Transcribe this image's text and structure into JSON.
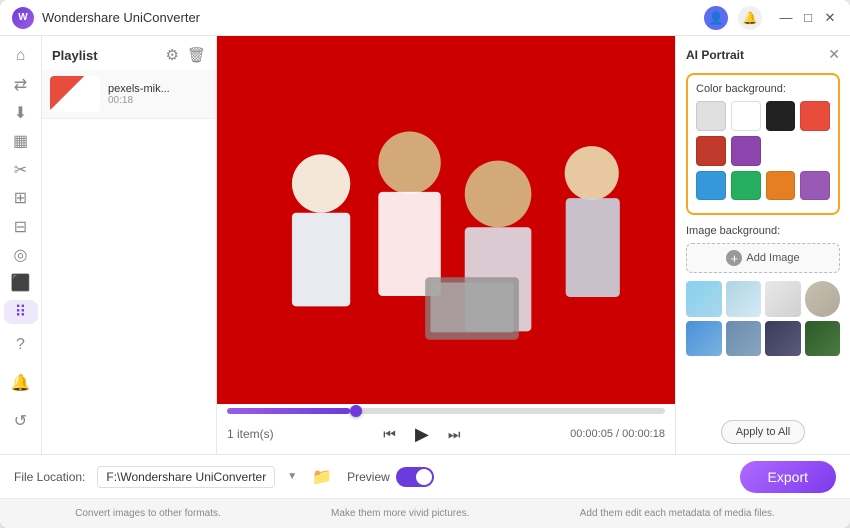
{
  "app": {
    "title": "Wondershare UniConverter",
    "logo_text": "W"
  },
  "titlebar": {
    "icons": [
      "user-icon",
      "bell-icon"
    ],
    "controls": [
      "minimize",
      "maximize",
      "close"
    ],
    "minimize_label": "—",
    "maximize_label": "□",
    "close_label": "✕"
  },
  "sidebar": {
    "items": [
      {
        "id": "home",
        "icon": "⌂",
        "label": "Home"
      },
      {
        "id": "convert",
        "icon": "↔",
        "label": "Convert"
      },
      {
        "id": "download",
        "icon": "↓",
        "label": "Download"
      },
      {
        "id": "screen",
        "icon": "▦",
        "label": "Screen"
      },
      {
        "id": "cut",
        "icon": "✂",
        "label": "Cut"
      },
      {
        "id": "merge",
        "icon": "⊞",
        "label": "Merge"
      },
      {
        "id": "watermark",
        "icon": "⊟",
        "label": "Watermark"
      },
      {
        "id": "effects",
        "icon": "◈",
        "label": "Effects"
      },
      {
        "id": "toolbox",
        "icon": "⊞",
        "label": "Toolbox"
      },
      {
        "id": "ai",
        "icon": "⠿",
        "label": "AI Tools",
        "active": true
      }
    ],
    "bottom": [
      {
        "id": "help",
        "icon": "?",
        "label": "Help"
      },
      {
        "id": "notifications",
        "icon": "🔔",
        "label": "Notifications"
      },
      {
        "id": "settings",
        "icon": "↺",
        "label": "Settings"
      }
    ]
  },
  "playlist": {
    "title": "Playlist",
    "count_label": "1 item(s)",
    "items": [
      {
        "name": "pexels-mik...",
        "duration": "00:18"
      }
    ]
  },
  "video": {
    "current_time": "00:00:05",
    "total_time": "00:00:18",
    "progress_pct": 28
  },
  "right_panel": {
    "title": "AI Portrait",
    "color_background_label": "Color background:",
    "image_background_label": "Image background:",
    "add_image_label": "Add Image",
    "apply_all_label": "Apply to All",
    "colors": [
      {
        "hex": "#e0e0e0",
        "label": "Light Gray"
      },
      {
        "hex": "#ffffff",
        "label": "White"
      },
      {
        "hex": "#222222",
        "label": "Black"
      },
      {
        "hex": "#e74c3c",
        "label": "Red"
      },
      {
        "hex": "#c0392b",
        "label": "Dark Red"
      },
      {
        "hex": "#8e44ad",
        "label": "Purple"
      },
      {
        "hex": "#3498db",
        "label": "Blue"
      },
      {
        "hex": "#27ae60",
        "label": "Green"
      },
      {
        "hex": "#e67e22",
        "label": "Orange"
      },
      {
        "hex": "#9b59b6",
        "label": "Violet"
      }
    ]
  },
  "footer": {
    "file_location_label": "File Location:",
    "file_path": "F:\\Wondershare UniConverter",
    "preview_label": "Preview",
    "export_label": "Export"
  },
  "bottom_bar": {
    "items": [
      "Convert images to other formats.",
      "Make them more vivid pictures.",
      "Add them edit each metadata of media files."
    ]
  }
}
